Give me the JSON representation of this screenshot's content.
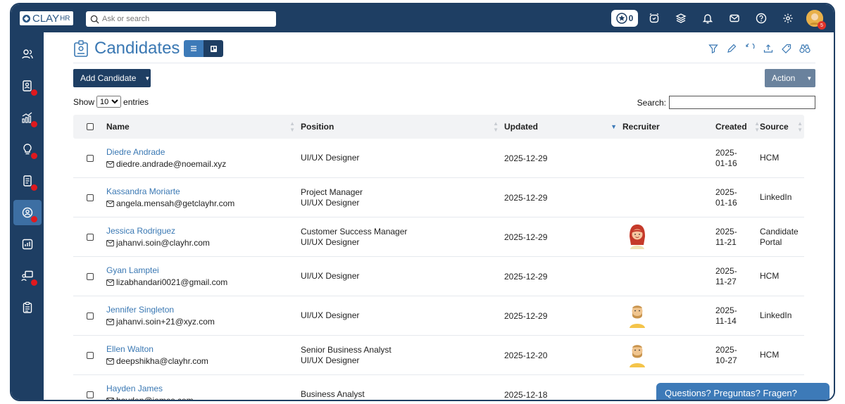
{
  "app": {
    "logo_text": "CLAY",
    "logo_suffix": "HR",
    "search_placeholder": "Ask or search",
    "star_count": "0",
    "avatar_badge": "5"
  },
  "page": {
    "title": "Candidates",
    "add_button": "Add Candidate",
    "action_button": "Action",
    "show_label": "Show",
    "entries_value": "10",
    "entries_label": "entries",
    "search_label": "Search:"
  },
  "table": {
    "headers": {
      "name": "Name",
      "position": "Position",
      "updated": "Updated",
      "recruiter": "Recruiter",
      "created": "Created",
      "source": "Source"
    },
    "rows": [
      {
        "name": "Diedre Andrade",
        "email": "diedre.andrade@noemail.xyz",
        "pos1": "UI/UX Designer",
        "pos2": "",
        "updated": "2025-12-29",
        "recruiter": "",
        "created1": "2025-",
        "created2": "01-16",
        "source1": "HCM",
        "source2": ""
      },
      {
        "name": "Kassandra Moriarte",
        "email": "angela.mensah@getclayhr.com",
        "pos1": "Project Manager",
        "pos2": "UI/UX Designer",
        "updated": "2025-12-29",
        "recruiter": "",
        "created1": "2025-",
        "created2": "01-16",
        "source1": "LinkedIn",
        "source2": ""
      },
      {
        "name": "Jessica Rodriguez",
        "email": "jahanvi.soin@clayhr.com",
        "pos1": "Customer Success Manager",
        "pos2": "UI/UX Designer",
        "updated": "2025-12-29",
        "recruiter": "female-avatar",
        "created1": "2025-",
        "created2": "11-21",
        "source1": "Candidate",
        "source2": "Portal"
      },
      {
        "name": "Gyan Lamptei",
        "email": "lizabhandari0021@gmail.com",
        "pos1": "UI/UX Designer",
        "pos2": "",
        "updated": "2025-12-29",
        "recruiter": "",
        "created1": "2025-",
        "created2": "11-27",
        "source1": "HCM",
        "source2": ""
      },
      {
        "name": "Jennifer Singleton",
        "email": "jahanvi.soin+21@xyz.com",
        "pos1": "UI/UX Designer",
        "pos2": "",
        "updated": "2025-12-29",
        "recruiter": "male-avatar",
        "created1": "2025-",
        "created2": "11-14",
        "source1": "LinkedIn",
        "source2": ""
      },
      {
        "name": "Ellen Walton",
        "email": "deepshikha@clayhr.com",
        "pos1": "Senior Business Analyst",
        "pos2": "UI/UX Designer",
        "updated": "2025-12-20",
        "recruiter": "male-avatar",
        "created1": "2025-",
        "created2": "10-27",
        "source1": "HCM",
        "source2": ""
      },
      {
        "name": "Hayden James",
        "email": "hayden@james.com",
        "pos1": "Business Analyst",
        "pos2": "",
        "updated": "2025-12-18",
        "recruiter": "",
        "created1": "",
        "created2": "",
        "source1": "",
        "source2": ""
      }
    ]
  },
  "chat": {
    "label": "Questions? Preguntas? Fragen?"
  },
  "colors": {
    "navy": "#1e3e63",
    "link": "#3a78b3",
    "notification": "#e0191e"
  }
}
